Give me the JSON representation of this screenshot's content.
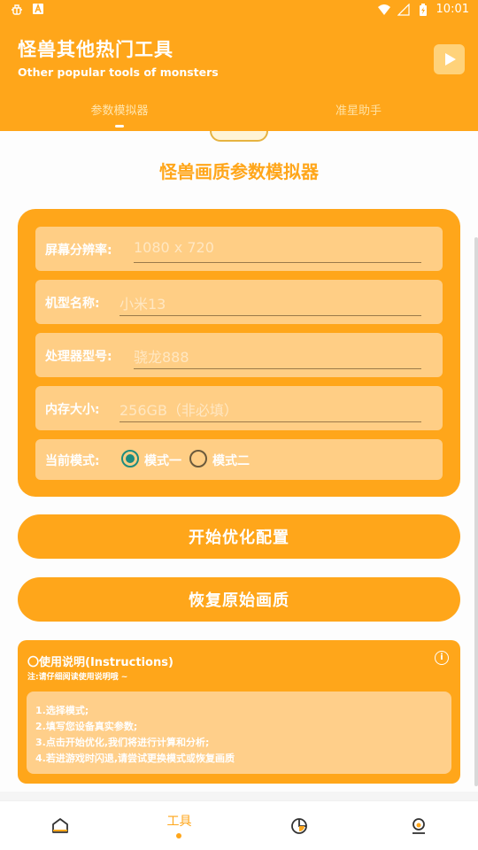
{
  "status_bar": {
    "time": "10:01"
  },
  "header": {
    "title": "怪兽其他热门工具",
    "subtitle": "Other popular tools of monsters",
    "tabs": [
      {
        "label": "参数模拟器",
        "active": true
      },
      {
        "label": "准星助手",
        "active": false
      }
    ]
  },
  "main": {
    "page_title": "怪兽画质参数模拟器",
    "fields": [
      {
        "label": "屏幕分辨率:",
        "placeholder": "1080 x 720"
      },
      {
        "label": "机型名称:",
        "placeholder": "小米13"
      },
      {
        "label": "处理器型号:",
        "placeholder": "骁龙888"
      },
      {
        "label": "内存大小:",
        "placeholder": "256GB（非必填）"
      }
    ],
    "mode": {
      "label": "当前模式:",
      "options": [
        {
          "label": "模式一",
          "selected": true
        },
        {
          "label": "模式二",
          "selected": false
        }
      ]
    },
    "start_button": "开始优化配置",
    "restore_button": "恢复原始画质",
    "instructions": {
      "title": "〇使用说明(Instructions)",
      "note": "注:请仔细阅读使用说明哦 ~",
      "steps": [
        "1.选择模式;",
        "2.填写您设备真实参数;",
        "3.点击开始优化,我们将进行计算和分析;",
        "4.若进游戏时闪退,请尝试更换模式或恢复画质"
      ]
    }
  },
  "bottom_nav": {
    "items": [
      {
        "icon": "home-icon",
        "label": ""
      },
      {
        "icon": "tools",
        "label": "工具",
        "active": true
      },
      {
        "icon": "pie-chart-icon",
        "label": ""
      },
      {
        "icon": "profile-icon",
        "label": ""
      }
    ]
  },
  "colors": {
    "primary": "#ffa61a",
    "field_bg": "#ffce85",
    "radio_checked": "#1e8c7e"
  }
}
